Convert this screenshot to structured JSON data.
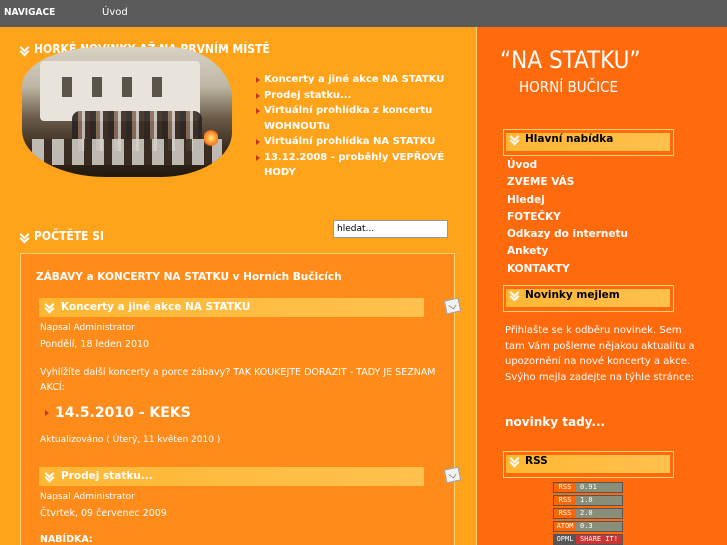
{
  "topbar": {
    "title": "NAVIGACE",
    "home_link": "Úvod"
  },
  "hot_news": {
    "title": "HORKÉ NOVINKY AŽ NA PRVNÍM MÍSTĚ",
    "items": [
      "Koncerty a jiné akce NA STATKU",
      "Prodej statku...",
      "Virtuální prohlídka z koncertu WOHNOUTu",
      "Virtuální prohlídka NA STATKU",
      "13.12.2008 - proběhly VEPŘOVÉ HODY"
    ]
  },
  "read": {
    "title": "POČTĚTE SI",
    "search_value": "hledat..."
  },
  "content": {
    "box_title": "ZÁBAVY a KONCERTY NA STATKU v Horních Bučicích",
    "article1": {
      "title": "Koncerty a jiné akce NA STATKU",
      "author": "Napsal Administrator",
      "date": "Pondělí, 18 leden 2010",
      "text": "Vyhlížíte další koncerty a porce zábavy? TAK KOUKEJTE DORAZIT - TADY JE SEZNAM AKCÍ:",
      "event": "14.5.2010 - KEKS",
      "updated": "Aktualizováno ( Úterý, 11 květen 2010 )"
    },
    "article2": {
      "title": "Prodej statku...",
      "author": "Napsal Administrator",
      "date": "Čtvrtek, 09 červenec 2009",
      "section": "NABÍDKA:"
    }
  },
  "brand": {
    "line1": "“NA STATKU”",
    "line2": "HORNÍ BUČICE"
  },
  "main_menu": {
    "title": "Hlavní nabídka",
    "items": [
      "Úvod",
      "ZVEME VÁS",
      "Hledej",
      "FOTEČKY",
      "Odkazy do internetu",
      "Ankety",
      "KONTAKTY"
    ]
  },
  "newsletter": {
    "title": "Novinky mejlem",
    "text": "Přihlašte se k odběru novinek. Sem tam Vám pošleme nějakou aktualitu a upozornění na nové koncerty a akce. Svýho mejla zadejte na týhle stránce:",
    "link": "novinky tady..."
  },
  "rss": {
    "title": "RSS",
    "badges": [
      {
        "left": "RSS",
        "right": "0.91"
      },
      {
        "left": "RSS",
        "right": "1.0"
      },
      {
        "left": "RSS",
        "right": "2.0"
      },
      {
        "left": "ATOM",
        "right": "0.3"
      },
      {
        "left": "OPML",
        "right": "SHARE IT!"
      }
    ]
  },
  "colors": {
    "main_bg": "#ffa31a",
    "sidebar_bg": "#ff6a0d",
    "topbar_bg": "#5a5a5a",
    "accent_bar": "#ffb733"
  }
}
